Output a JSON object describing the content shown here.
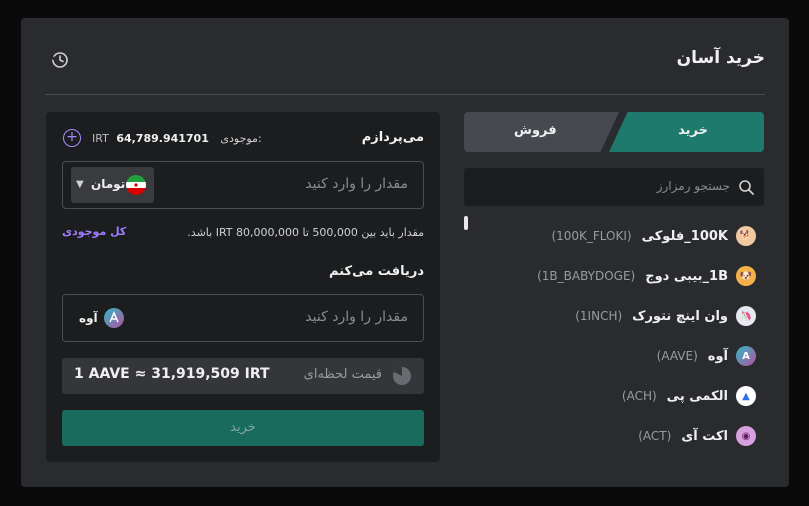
{
  "header": {
    "title": "خرید آسان",
    "history_icon": "history-icon"
  },
  "tabs": {
    "sell_label": "فروش",
    "buy_label": "خرید",
    "active": "buy"
  },
  "search": {
    "placeholder": "جستجو رمزارز"
  },
  "coins": [
    {
      "name": "100K_فلوکی",
      "symbol": "(100K_FLOKI)",
      "icon": "floki-icon",
      "color": "#f0c9a0"
    },
    {
      "name": "1B_بیبی دوج",
      "symbol": "(1B_BABYDOGE)",
      "icon": "babydoge-icon",
      "color": "#f5b24a"
    },
    {
      "name": "وان اینچ نتورک",
      "symbol": "(1INCH)",
      "icon": "1inch-icon",
      "color": "#e8e8f0"
    },
    {
      "name": "آوه",
      "symbol": "(AAVE)",
      "icon": "aave-icon",
      "color": "#b6509e"
    },
    {
      "name": "الکمی پی",
      "symbol": "(ACH)",
      "icon": "ach-icon",
      "color": "#2e6ff0"
    },
    {
      "name": "اکت آی",
      "symbol": "(ACT)",
      "icon": "act-icon",
      "color": "#d9a0e0"
    }
  ],
  "pay": {
    "label": "می‌پردازم",
    "balance_label": "موجودی:",
    "balance_value": "64,789.941701",
    "balance_currency": "IRT",
    "placeholder": "مقدار را وارد کنید",
    "currency": "تومان",
    "hint": "مقدار باید بین 500,000 تا IRT 80,000,000 باشد.",
    "all_balance": "کل موجودی"
  },
  "receive": {
    "label": "دریافت می‌کنم",
    "placeholder": "مقدار را وارد کنید",
    "asset": "آوه"
  },
  "rate": {
    "label": "قیمت لحظه‌ای",
    "value": "1 AAVE ≈ 31,919,509 IRT"
  },
  "action": {
    "buy_label": "خرید"
  },
  "colors": {
    "accent": "#1e7a6c",
    "purple": "#9f7dff",
    "bg": "#2a2b2e"
  }
}
